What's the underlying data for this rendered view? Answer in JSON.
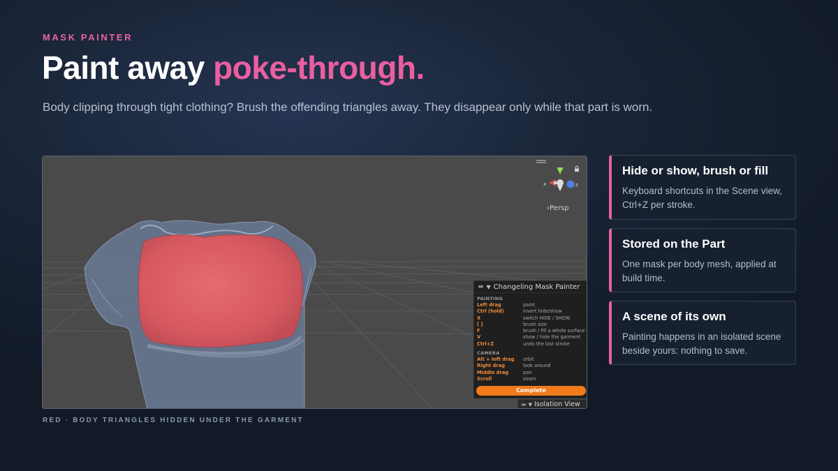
{
  "header": {
    "eyebrow": "MASK PAINTER",
    "title_main": "Paint away ",
    "title_accent": "poke-through.",
    "subtitle": "Body clipping through tight clothing? Brush the offending triangles away. They disappear only while that part is worn."
  },
  "viewport": {
    "gizmo": {
      "y_label": "y",
      "x_label": "x",
      "z_label": "z"
    },
    "persp_label": "‹Persp",
    "panel": {
      "title": "Changeling Mask Painter",
      "painting_label": "PAINTING",
      "painting_rows": [
        {
          "key": "Left drag",
          "desc": "paint"
        },
        {
          "key": "Ctrl (hold)",
          "desc": "invert hide/show"
        },
        {
          "key": "X",
          "desc": "switch HIDE / SHOW"
        },
        {
          "key": "[ ]",
          "desc": "brush size"
        },
        {
          "key": "F",
          "desc": "brush / fill a whole surface"
        },
        {
          "key": "V",
          "desc": "show / hide the garment"
        },
        {
          "key": "Ctrl+Z",
          "desc": "undo the last stroke"
        }
      ],
      "camera_label": "CAMERA",
      "camera_rows": [
        {
          "key": "Alt + left drag",
          "desc": "orbit"
        },
        {
          "key": "Right drag",
          "desc": "look around"
        },
        {
          "key": "Middle drag",
          "desc": "pan"
        },
        {
          "key": "Scroll",
          "desc": "zoom"
        }
      ],
      "complete_label": "Complete"
    },
    "isolation_label": "Isolation View"
  },
  "caption": "RED  ·  BODY TRIANGLES HIDDEN UNDER THE GARMENT",
  "cards": [
    {
      "title": "Hide or show, brush or fill",
      "body": "Keyboard shortcuts in the Scene view, Ctrl+Z per stroke."
    },
    {
      "title": "Stored on the Part",
      "body": "One mask per body mesh, applied at build time."
    },
    {
      "title": "A scene of its own",
      "body": "Painting happens in an isolated scene beside yours: nothing to save."
    }
  ],
  "colors": {
    "accent_pink": "#ea5fa0",
    "button_orange": "#f07a1c",
    "shortcut_key_orange": "#f08a38",
    "mask_red": "#e0565c"
  }
}
